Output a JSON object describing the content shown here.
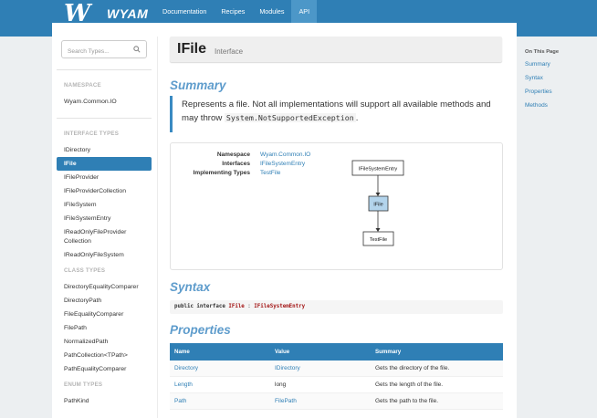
{
  "header": {
    "logo_text": "WYAM",
    "logo_mark": "W",
    "nav": [
      {
        "label": "Documentation"
      },
      {
        "label": "Recipes"
      },
      {
        "label": "Modules"
      },
      {
        "label": "API",
        "active": true
      }
    ]
  },
  "sidebar": {
    "search_placeholder": "Search Types...",
    "namespace_heading": "NAMESPACE",
    "namespace": "Wyam.Common.IO",
    "interface_heading": "INTERFACE TYPES",
    "interfaces": [
      "IDirectory",
      "IFile",
      "IFileProvider",
      "IFileProviderCollection",
      "IFileSystem",
      "IFileSystemEntry",
      "IReadOnlyFileProvider Collection",
      "IReadOnlyFileSystem"
    ],
    "class_heading": "CLASS TYPES",
    "classes": [
      "DirectoryEqualityComparer",
      "DirectoryPath",
      "FileEqualityComparer",
      "FilePath",
      "NormalizedPath",
      "PathCollection<TPath>",
      "PathEqualityComparer"
    ],
    "enum_heading": "ENUM TYPES",
    "enums": [
      "PathKind"
    ]
  },
  "main": {
    "title": "IFile",
    "title_type": "Interface",
    "summary_heading": "Summary",
    "summary_text_1": "Represents a file. Not all implementations will support all available methods and may throw",
    "summary_code": "System.NotSupportedException",
    "summary_text_2": ".",
    "info": {
      "namespace_label": "Namespace",
      "namespace_value": "Wyam.Common.IO",
      "interfaces_label": "Interfaces",
      "interfaces_value": "IFileSystemEntry",
      "implementing_label": "Implementing Types",
      "implementing_value": "TestFile"
    },
    "diagram": {
      "top": "IFileSystemEntry",
      "middle": "IFile",
      "bottom": "TestFile",
      "highlight_color": "#b3d4ec"
    },
    "syntax_heading": "Syntax",
    "syntax": {
      "prefix": "public interface",
      "name": "IFile",
      "sep": ":",
      "base": "IFileSystemEntry"
    },
    "properties_heading": "Properties",
    "properties_columns": [
      "Name",
      "Value",
      "Summary"
    ],
    "properties": [
      {
        "name": "Directory",
        "value": "IDirectory",
        "value_link": true,
        "summary": "Gets the directory of the file."
      },
      {
        "name": "Length",
        "value": "long",
        "value_link": false,
        "summary": "Gets the length of the file."
      },
      {
        "name": "Path",
        "value": "FilePath",
        "value_link": true,
        "summary": "Gets the path to the file."
      }
    ]
  },
  "on_this_page": {
    "heading": "On This Page",
    "items": [
      "Summary",
      "Syntax",
      "Properties",
      "Methods"
    ]
  },
  "colors": {
    "accent": "#2f7fb5",
    "heading": "#5e9ccc"
  }
}
